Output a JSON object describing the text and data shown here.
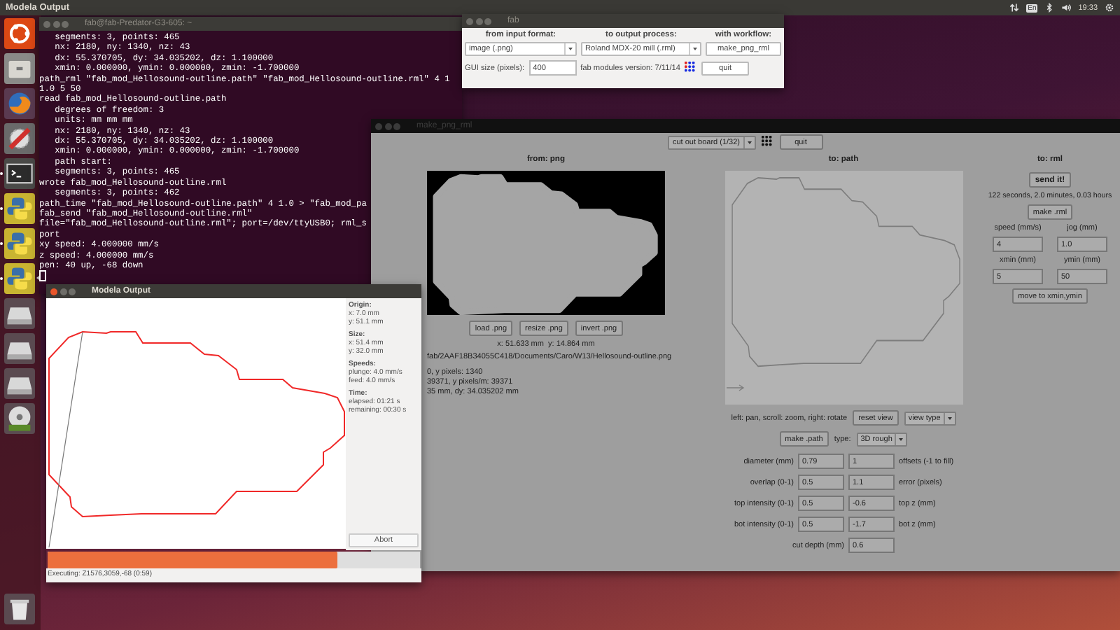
{
  "top_bar": {
    "app_title": "Modela Output",
    "keyboard_layout": "En",
    "clock": "19:33"
  },
  "launcher": [
    {
      "kind": "ubuntu",
      "running": false,
      "focused": false
    },
    {
      "kind": "files",
      "running": false,
      "focused": false
    },
    {
      "kind": "browser",
      "running": false,
      "focused": false
    },
    {
      "kind": "tools",
      "running": false,
      "focused": false
    },
    {
      "kind": "terminal",
      "running": true,
      "focused": false
    },
    {
      "kind": "python",
      "running": true,
      "focused": false
    },
    {
      "kind": "python",
      "running": true,
      "focused": false
    },
    {
      "kind": "python",
      "running": true,
      "focused": true
    },
    {
      "kind": "drive",
      "running": false,
      "focused": false
    },
    {
      "kind": "drive",
      "running": false,
      "focused": false
    },
    {
      "kind": "drive",
      "running": false,
      "focused": false
    },
    {
      "kind": "dvd",
      "running": false,
      "focused": false
    }
  ],
  "terminal": {
    "title": "fab@fab-Predator-G3-605: ~",
    "lines": [
      "   segments: 3, points: 465",
      "   nx: 2180, ny: 1340, nz: 43",
      "   dx: 55.370705, dy: 34.035202, dz: 1.100000",
      "   xmin: 0.000000, ymin: 0.000000, zmin: -1.700000",
      "path_rml \"fab_mod_Hellosound-outline.path\" \"fab_mod_Hellosound-outline.rml\" 4 1",
      "1.0 5 50",
      "read fab_mod_Hellosound-outline.path",
      "   degrees of freedom: 3",
      "   units: mm mm mm",
      "   nx: 2180, ny: 1340, nz: 43",
      "   dx: 55.370705, dy: 34.035202, dz: 1.100000",
      "   xmin: 0.000000, ymin: 0.000000, zmin: -1.700000",
      "   path start:",
      "   segments: 3, points: 465",
      "wrote fab_mod_Hellosound-outline.rml",
      "   segments: 3, points: 462",
      "path_time \"fab_mod_Hellosound-outline.path\" 4 1.0 > \"fab_mod_pa",
      "fab_send \"fab_mod_Hellosound-outline.rml\"",
      "file=\"fab_mod_Hellosound-outline.rml\"; port=/dev/ttyUSB0; rml_s",
      "port",
      "xy speed: 4.000000 mm/s",
      "z speed: 4.000000 mm/s",
      "pen: 40 up, -68 down"
    ]
  },
  "fab_window": {
    "title": "fab",
    "headers": [
      "from input format:",
      "to output process:",
      "with workflow:"
    ],
    "input_format": "image (.png)",
    "output_process": "Roland MDX-20 mill (.rml)",
    "workflow_button": "make_png_rml",
    "gui_size_label": "GUI size (pixels):",
    "gui_size": "400",
    "version": "fab modules version: 7/11/14",
    "quit": "quit"
  },
  "make_png_rml": {
    "title": "make_png_rml",
    "process": "cut out board (1/32)",
    "quit": "quit",
    "from_header": "from: png",
    "png_buttons": [
      "load .png",
      "resize .png",
      "invert .png"
    ],
    "cursor": "x: 51.633 mm  y: 14.864 mm",
    "file_path": "fab/2AAF18B34055C418/Documents/Caro/W13/Hellosound-outline.png",
    "info_lines": [
      "0, y pixels: 1340",
      "39371, y pixels/m: 39371",
      "35 mm, dy: 34.035202 mm"
    ],
    "path_header": "to: path",
    "view_hint": "left: pan, scroll: zoom, right: rotate",
    "reset_view": "reset view",
    "view_type": "view type",
    "make_path": "make .path",
    "type_label": "type:",
    "type": "3D rough",
    "params": [
      {
        "left_label": "diameter (mm)",
        "left_value": "0.79",
        "right_value": "1",
        "right_label": "offsets (-1 to fill)"
      },
      {
        "left_label": "overlap (0-1)",
        "left_value": "0.5",
        "right_value": "1.1",
        "right_label": "error (pixels)"
      },
      {
        "left_label": "top intensity (0-1)",
        "left_value": "0.5",
        "right_value": "-0.6",
        "right_label": "top z (mm)"
      },
      {
        "left_label": "bot intensity (0-1)",
        "left_value": "0.5",
        "right_value": "-1.7",
        "right_label": "bot z (mm)"
      }
    ],
    "cut_depth_label": "cut depth (mm)",
    "cut_depth": "0.6",
    "rml_header": "to: rml",
    "send": "send it!",
    "estimate": "122 seconds, 2.0 minutes, 0.03 hours",
    "make_rml": "make .rml",
    "rml_fields": [
      {
        "label": "speed (mm/s)",
        "value": "4"
      },
      {
        "label": "jog (mm)",
        "value": "1.0"
      },
      {
        "label": "xmin (mm)",
        "value": "5"
      },
      {
        "label": "ymin (mm)",
        "value": "50"
      }
    ],
    "move_button": "move to xmin,ymin"
  },
  "modela_output": {
    "title": "Modela Output",
    "info": [
      {
        "heading": "Origin:",
        "lines": [
          "x: 7.0 mm",
          "y: 51.1 mm"
        ]
      },
      {
        "heading": "Size:",
        "lines": [
          "x: 51.4 mm",
          "y: 32.0 mm"
        ]
      },
      {
        "heading": "Speeds:",
        "lines": [
          "plunge: 4.0 mm/s",
          "feed: 4.0 mm/s"
        ]
      },
      {
        "heading": "Time:",
        "lines": [
          "elapsed: 01:21 s",
          "remaining: 00:30 s"
        ]
      }
    ],
    "abort": "Abort",
    "progress": {
      "level": 0.78
    },
    "status": "Executing: Z1576,3059,-68 (0:59)"
  }
}
